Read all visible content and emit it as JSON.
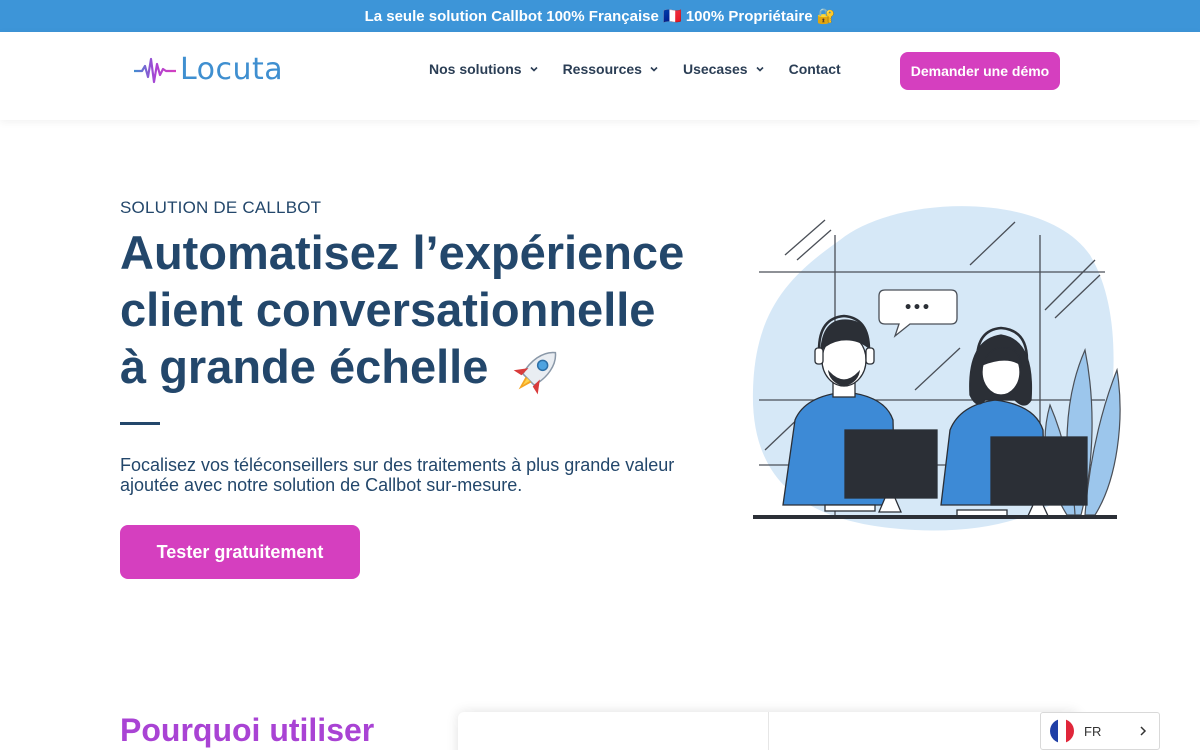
{
  "topbar": {
    "text": "La seule solution Callbot 100% Française 🇫🇷  100% Propriétaire 🔐"
  },
  "header": {
    "logo": "Locuta",
    "nav": [
      {
        "label": "Nos solutions",
        "has_dropdown": true
      },
      {
        "label": "Ressources",
        "has_dropdown": true
      },
      {
        "label": "Usecases",
        "has_dropdown": true
      },
      {
        "label": "Contact",
        "has_dropdown": false
      }
    ],
    "cta": "Demander une démo"
  },
  "hero": {
    "eyebrow": "SOLUTION DE CALLBOT",
    "title_line1": "Automatisez l’expérience",
    "title_line2": "client conversationnelle",
    "title_line3": "à grande échelle",
    "title_emoji": "rocket-icon",
    "description": "Focalisez vos téléconseillers sur des traitements à plus grande valeur ajoutée avec notre solution de Callbot sur-mesure.",
    "cta": "Tester gratuitement",
    "speech_bubble": "•••"
  },
  "section": {
    "title": "Pourquoi utiliser"
  },
  "language": {
    "code": "FR",
    "flag": "france-flag-icon"
  },
  "colors": {
    "topbar": "#3d95d8",
    "accent": "#d53fbf",
    "heading": "#23476b",
    "purple": "#a943d4"
  }
}
